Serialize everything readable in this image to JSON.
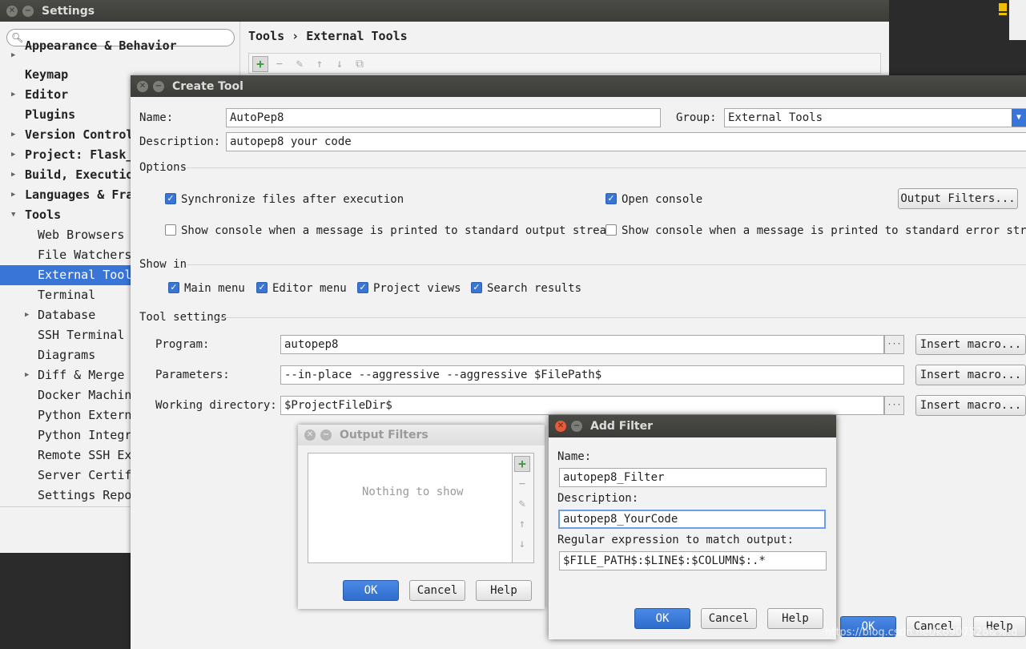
{
  "settings": {
    "title": "Settings",
    "breadcrumb": "Tools › External Tools",
    "tree": [
      {
        "label": "Appearance & Behavior"
      },
      {
        "label": "Keymap"
      },
      {
        "label": "Editor"
      },
      {
        "label": "Plugins"
      },
      {
        "label": "Version Control"
      },
      {
        "label": "Project: Flask_"
      },
      {
        "label": "Build, Execution"
      },
      {
        "label": "Languages & Fra"
      },
      {
        "label": "Tools"
      },
      {
        "label": "Web Browsers"
      },
      {
        "label": "File Watchers"
      },
      {
        "label": "External Tools"
      },
      {
        "label": "Terminal"
      },
      {
        "label": "Database"
      },
      {
        "label": "SSH Terminal"
      },
      {
        "label": "Diagrams"
      },
      {
        "label": "Diff & Merge"
      },
      {
        "label": "Docker Machine"
      },
      {
        "label": "Python External"
      },
      {
        "label": "Python Integrat"
      },
      {
        "label": "Remote SSH Exte"
      },
      {
        "label": "Server Certific"
      },
      {
        "label": "Settings Reposi"
      }
    ]
  },
  "create_tool": {
    "title": "Create Tool",
    "name_label": "Name:",
    "name_value": "AutoPep8",
    "group_label": "Group:",
    "group_value": "External Tools",
    "description_label": "Description:",
    "description_value": "autopep8 your code",
    "options_header": "Options",
    "sync_label": "Synchronize files after execution",
    "open_console_label": "Open console",
    "output_filters_button": "Output Filters...",
    "show_console_stdout_label": "Show console when a message is printed to standard output stream",
    "show_console_stderr_label": "Show console when a message is printed to standard error stream",
    "show_in_header": "Show in",
    "main_menu_label": "Main menu",
    "editor_menu_label": "Editor menu",
    "project_views_label": "Project views",
    "search_results_label": "Search results",
    "tool_settings_header": "Tool settings",
    "program_label": "Program:",
    "program_value": "autopep8",
    "parameters_label": "Parameters:",
    "parameters_value": "--in-place --aggressive --aggressive $FilePath$",
    "working_dir_label": "Working directory:",
    "working_dir_value": "$ProjectFileDir$",
    "insert_macro": "Insert macro...",
    "ok": "OK",
    "cancel": "Cancel",
    "help": "Help"
  },
  "output_filters": {
    "title": "Output Filters",
    "empty_text": "Nothing to show",
    "ok": "OK",
    "cancel": "Cancel",
    "help": "Help"
  },
  "add_filter": {
    "title": "Add Filter",
    "name_label": "Name:",
    "name_value": "autopep8_Filter",
    "description_label": "Description:",
    "description_value": "autopep8_YourCode",
    "regex_label": "Regular expression to match output:",
    "regex_value": "$FILE_PATH$:$LINE$:$COLUMN$:.*",
    "ok": "OK",
    "cancel": "Cancel",
    "help": "Help"
  },
  "watermark": "https://blog.csdn.net/k6907528&%!d",
  "colors": {
    "selection": "#3875d7",
    "add_green": "#3a9a3a",
    "close_red": "#e25b3a"
  }
}
